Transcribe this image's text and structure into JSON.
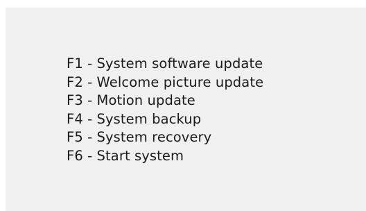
{
  "boot_menu": {
    "items": [
      {
        "label": "F1 - System software update"
      },
      {
        "label": "F2 - Welcome picture update"
      },
      {
        "label": "F3 - Motion update"
      },
      {
        "label": "F4 - System backup"
      },
      {
        "label": "F5 - System recovery"
      },
      {
        "label": "F6 - Start system"
      }
    ]
  },
  "colors": {
    "background": "#f0f0f0",
    "text": "#1a1a1a"
  }
}
